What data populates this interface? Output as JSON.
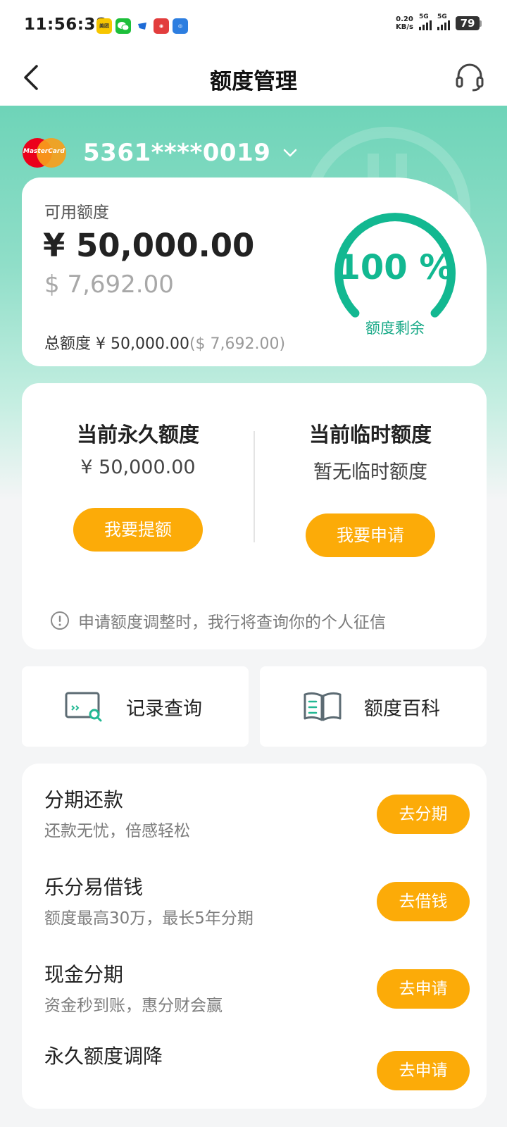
{
  "status": {
    "time": "11:56:38",
    "net_speed_value": "0.20",
    "net_speed_unit": "KB/s",
    "signal1": "5G",
    "signal2": "5G",
    "battery": "79"
  },
  "nav": {
    "title": "额度管理"
  },
  "card": {
    "number": "5361****0019",
    "brand_text": "MasterCard"
  },
  "available": {
    "label": "可用额度",
    "cny": "¥ 50,000.00",
    "usd": "$ 7,692.00",
    "total_label": "总额度 ¥ 50,000.00",
    "total_usd": "($ 7,692.00)",
    "remaining_percent": "100 %",
    "remaining_fraction": 1.0,
    "remaining_label": "额度剩余"
  },
  "limits": {
    "permanent_title": "当前永久额度",
    "permanent_value": "¥ 50,000.00",
    "permanent_button": "我要提额",
    "temporary_title": "当前临时额度",
    "temporary_value": "暂无临时额度",
    "temporary_button": "我要申请",
    "notice": "申请额度调整时，我行将查询你的个人征信"
  },
  "tiles": {
    "records": "记录查询",
    "encyclopedia": "额度百科"
  },
  "services": [
    {
      "title": "分期还款",
      "subtitle": "还款无忧，倍感轻松",
      "button": "去分期"
    },
    {
      "title": "乐分易借钱",
      "subtitle": "额度最高30万，最长5年分期",
      "button": "去借钱"
    },
    {
      "title": "现金分期",
      "subtitle": "资金秒到账，惠分财会赢",
      "button": "去申请"
    },
    {
      "title": "永久额度调降",
      "subtitle": "",
      "button": "去申请"
    }
  ],
  "colors": {
    "accent_green": "#12b891",
    "button_orange": "#fcab08",
    "hero_green": "#6ed4b8"
  }
}
